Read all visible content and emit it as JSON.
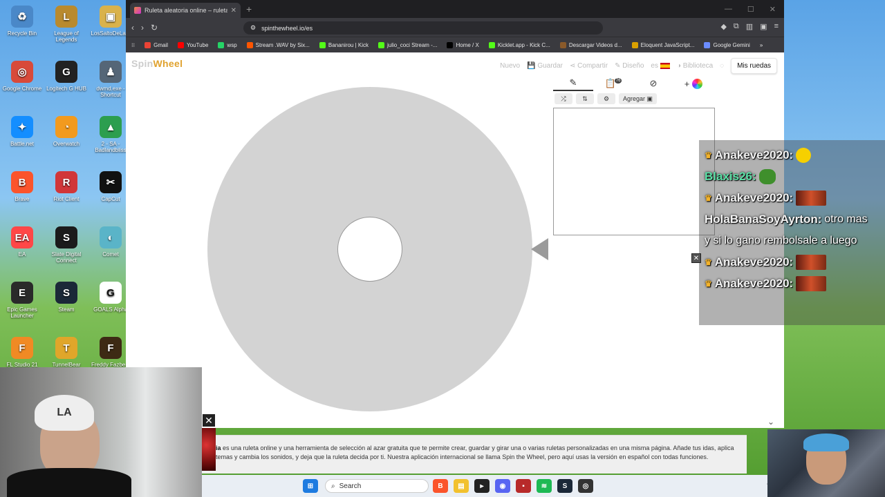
{
  "desktop": {
    "icons": [
      {
        "label": "Recycle Bin",
        "glyph": "♻",
        "color": "#4a88c8"
      },
      {
        "label": "League of Legends",
        "glyph": "L",
        "color": "#b98a2e"
      },
      {
        "label": "LosSaltoDeLa...",
        "glyph": "▣",
        "color": "#d9b24c"
      },
      {
        "label": "Google Chrome",
        "glyph": "◎",
        "color": "#d84a3a"
      },
      {
        "label": "Logitech G HUB",
        "glyph": "G",
        "color": "#222222"
      },
      {
        "label": "dwmd.exe - Shortcut",
        "glyph": "♟",
        "color": "#556677"
      },
      {
        "label": "Battle.net",
        "glyph": "✦",
        "color": "#148eff"
      },
      {
        "label": "Overwatch",
        "glyph": "◔",
        "color": "#f29a1e"
      },
      {
        "label": "2 - SA - Badlandbliss",
        "glyph": "▲",
        "color": "#2c9e4f"
      },
      {
        "label": "Brave",
        "glyph": "B",
        "color": "#fb542b"
      },
      {
        "label": "Riot Client",
        "glyph": "R",
        "color": "#d13639"
      },
      {
        "label": "CapCut",
        "glyph": "✂",
        "color": "#111111"
      },
      {
        "label": "EA",
        "glyph": "EA",
        "color": "#ff4747"
      },
      {
        "label": "Slate Digital Connect",
        "glyph": "S",
        "color": "#1b1b1b"
      },
      {
        "label": "Comet",
        "glyph": "◐",
        "color": "#5ab4c8"
      },
      {
        "label": "Epic Games Launcher",
        "glyph": "E",
        "color": "#2a2a2a"
      },
      {
        "label": "Steam",
        "glyph": "S",
        "color": "#1b2838"
      },
      {
        "label": "GOALS Alpha",
        "glyph": "G",
        "color": "#ffffff"
      },
      {
        "label": "FL Studio 21",
        "glyph": "F",
        "color": "#f08a24"
      },
      {
        "label": "TunnelBear",
        "glyph": "T",
        "color": "#e0a62a"
      },
      {
        "label": "Freddy Fazbe...",
        "glyph": "F",
        "color": "#3d2a14"
      }
    ]
  },
  "browser": {
    "tab_title": "Ruleta aleatoria online – ruleta d",
    "new_tab": "+",
    "url": "spinthewheel.io/es",
    "bookmarks": [
      {
        "label": "Gmail",
        "color": "#ea4335"
      },
      {
        "label": "YouTube",
        "color": "#ff0000"
      },
      {
        "label": "wsp",
        "color": "#25d366"
      },
      {
        "label": "Stream .WAV by Six...",
        "color": "#ff5500"
      },
      {
        "label": "Bananirou | Kick",
        "color": "#53fc18"
      },
      {
        "label": "julio_coci Stream -...",
        "color": "#53fc18"
      },
      {
        "label": "Home / X",
        "color": "#000000"
      },
      {
        "label": "Kicklet.app - Kick C...",
        "color": "#53fc18"
      },
      {
        "label": "Descargar Videos d...",
        "color": "#8a5a2a"
      },
      {
        "label": "Eloquent JavaScript...",
        "color": "#d9a000"
      },
      {
        "label": "Google Gemini",
        "color": "#6b8cff"
      }
    ]
  },
  "page": {
    "logo_part1": "Spin",
    "logo_part2": "Wheel",
    "menu": {
      "nuevo": "Nuevo",
      "guardar": "Guardar",
      "compartir": "Compartir",
      "diseno": "Diseño",
      "lang": "es",
      "biblioteca": "Biblioteca",
      "mis_ruedas": "Mis ruedas"
    },
    "tool_badge": "76",
    "agregar": "Agregar",
    "footer_bold": "ia",
    "footer_text": " es una ruleta online y una herramienta de selección al azar gratuita que te permite crear, guardar y girar una o varias ruletas personalizadas en una misma página. Añade tus idas, aplica temas y cambia los sonidos, y deja que la ruleta decida por ti. Nuestra aplicación internacional se llama Spin the Wheel, pero aquí usas la versión en español con todas funciones.",
    "wheel_color": "#d3d3d3"
  },
  "taskbar": {
    "search": "Search"
  },
  "chat": {
    "messages": [
      {
        "user": "Anakeve2020:",
        "text": "",
        "emote": "face",
        "crown": true,
        "alt": false
      },
      {
        "user": "Blaxis26:",
        "text": "",
        "emote": "frog",
        "crown": false,
        "alt": true
      },
      {
        "user": "Anakeve2020:",
        "text": "",
        "emote": "fire",
        "crown": true,
        "alt": false
      },
      {
        "user": "HolaBanaSoyAyrton:",
        "text": "otro mas",
        "emote": "",
        "crown": false,
        "alt": false
      },
      {
        "user": "",
        "text": "y si lo gano rembolsale a luego",
        "emote": "",
        "crown": false,
        "alt": false
      },
      {
        "user": "Anakeve2020:",
        "text": "",
        "emote": "fire",
        "crown": true,
        "alt": false
      },
      {
        "user": "Anakeve2020:",
        "text": "",
        "emote": "fire",
        "crown": true,
        "alt": false
      }
    ]
  }
}
